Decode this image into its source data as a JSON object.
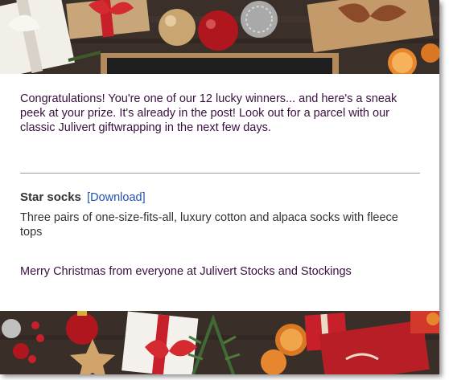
{
  "email": {
    "intro": "Congratulations! You're one of our 12 lucky winners... and here's a sneak peek at your prize. It's already in the post! Look out for a parcel with our classic Julivert giftwrapping in the next few days.",
    "product": {
      "title": "Star socks",
      "link_label": "[Download]",
      "description": "Three pairs of one-size-fits-all, luxury cotton and alpaca socks with fleece tops"
    },
    "signoff": "Merry Christmas from everyone at Julivert Stocks and Stockings"
  },
  "colors": {
    "text": "#3a1040",
    "link": "#2152b0",
    "wood": "#3b2f2a",
    "ribbon_red": "#c8202a"
  }
}
